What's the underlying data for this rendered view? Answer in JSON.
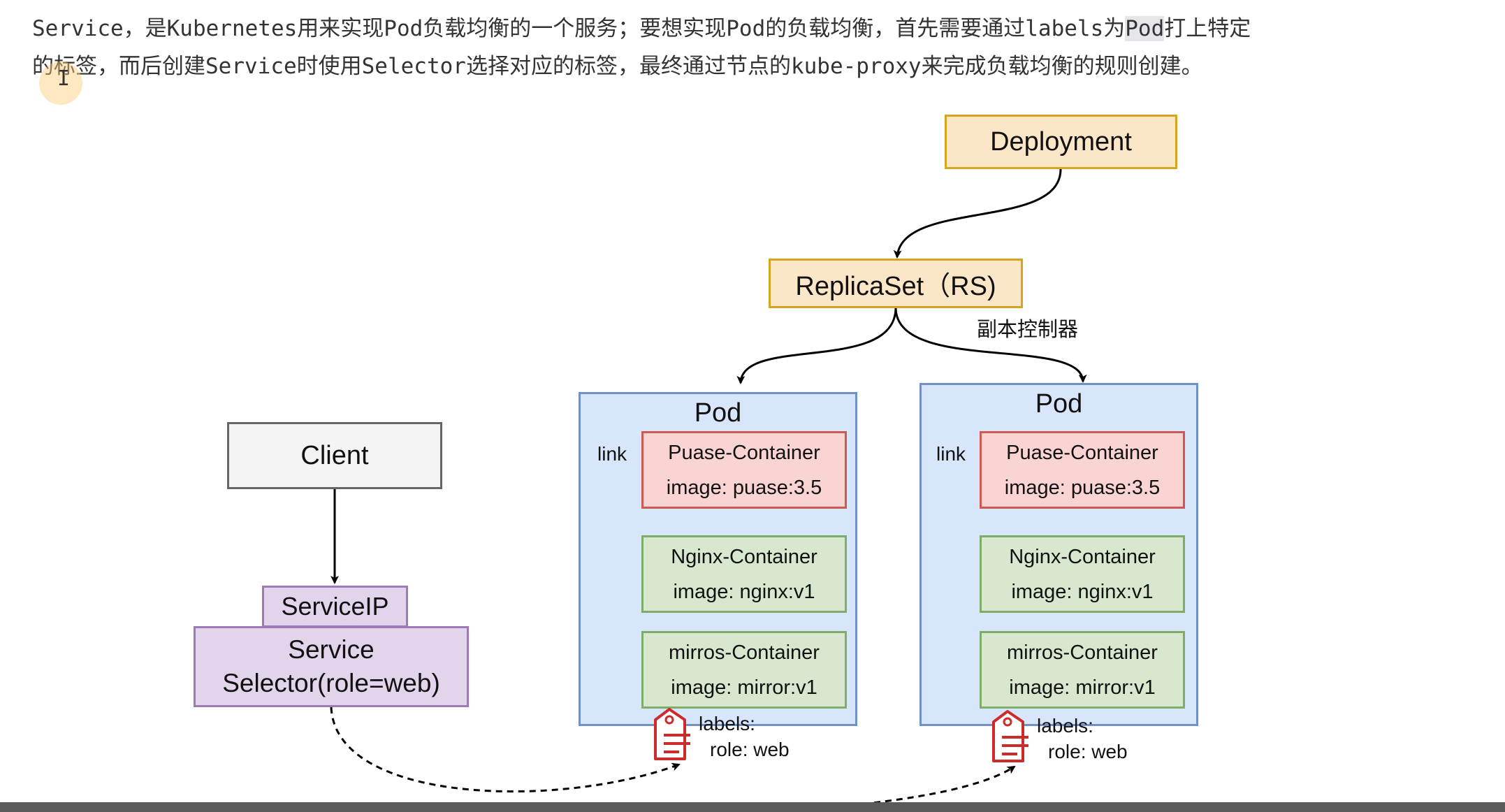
{
  "paragraph": {
    "line1_a": "Service，是Kubernetes用来实现Pod负载均衡的一个服务；要想实现Pod的负载均衡，首先需要通过labels为",
    "line1_hl": "Pod",
    "line1_b": "打上特定",
    "line2": "的标签，而后创建Service时使用Selector选择对应的标签，最终通过节点的kube-proxy来完成负载均衡的规则创建。"
  },
  "diagram": {
    "deployment": "Deployment",
    "replicaset": "ReplicaSet（RS)",
    "replicaset_note": "副本控制器",
    "client": "Client",
    "service_ip": "ServiceIP",
    "service_line1": "Service",
    "service_line2": "Selector(role=web)",
    "pods": [
      {
        "title": "Pod",
        "link": "link",
        "pause": [
          "Puase-Container",
          "image: puase:3.5"
        ],
        "nginx": [
          "Nginx-Container",
          "image: nginx:v1"
        ],
        "mirror": [
          "mirros-Container",
          "image: mirror:v1"
        ],
        "labels_title": "labels:",
        "labels_value": "role: web"
      },
      {
        "title": "Pod",
        "link": "link",
        "pause": [
          "Puase-Container",
          "image: puase:3.5"
        ],
        "nginx": [
          "Nginx-Container",
          "image: nginx:v1"
        ],
        "mirror": [
          "mirros-Container",
          "image: mirror:v1"
        ],
        "labels_title": "labels:",
        "labels_value": "role: web"
      }
    ]
  },
  "colors": {
    "orange_fill": "#fce6c8",
    "orange_border": "#d8a520",
    "purple_fill": "#e2d4ea",
    "blue_fill": "#d8e6fb",
    "red_fill": "#f9d4d2",
    "green_fill": "#d7e8cf",
    "tag_red": "#cc2b2b"
  },
  "icons": [
    "tag-icon",
    "text-cursor-icon"
  ]
}
